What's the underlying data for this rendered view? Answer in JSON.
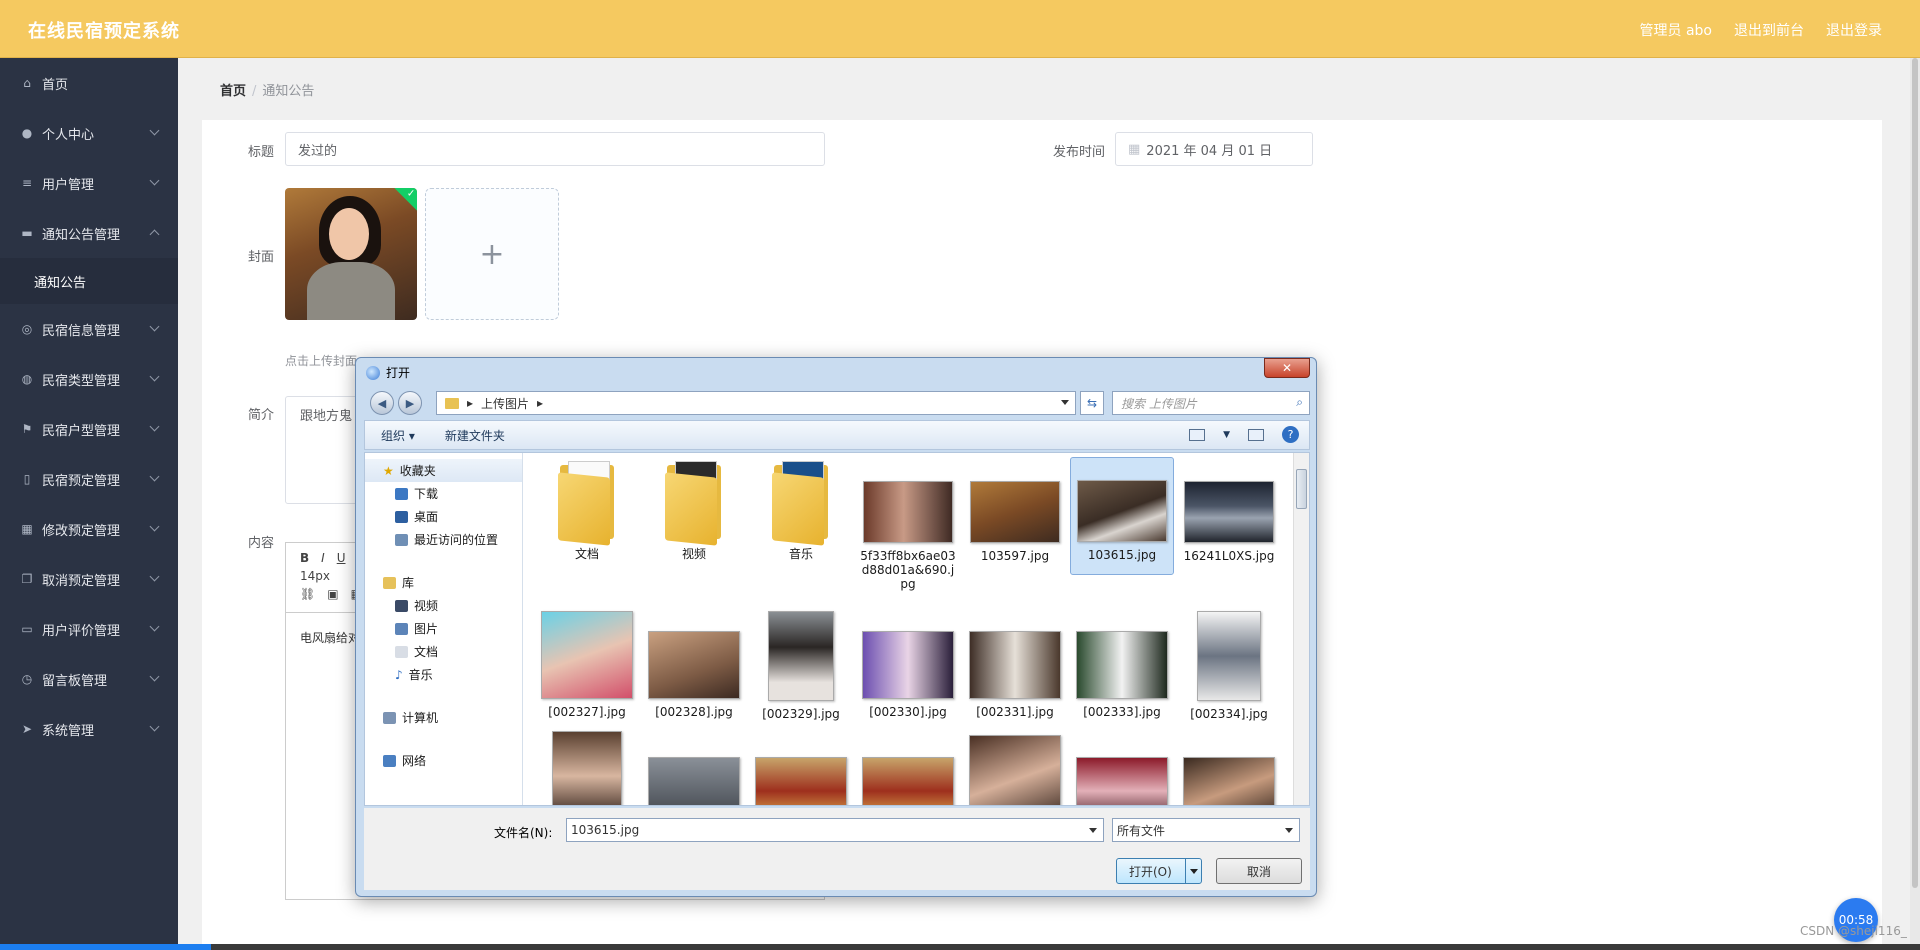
{
  "app": {
    "title": "在线民宿预定系统",
    "nav": [
      "管理员 abo",
      "退出到前台",
      "退出登录"
    ]
  },
  "sidebar": {
    "items": [
      {
        "label": "首页",
        "icon": "home-icon"
      },
      {
        "label": "个人中心",
        "icon": "user-icon"
      },
      {
        "label": "用户管理",
        "icon": "list-icon"
      },
      {
        "label": "通知公告管理",
        "icon": "briefcase-icon",
        "expanded": true
      },
      {
        "label": "民宿信息管理",
        "icon": "compass-icon"
      },
      {
        "label": "民宿类型管理",
        "icon": "globe-icon"
      },
      {
        "label": "民宿户型管理",
        "icon": "flag-icon"
      },
      {
        "label": "民宿预定管理",
        "icon": "bulb-icon"
      },
      {
        "label": "修改预定管理",
        "icon": "grid-icon"
      },
      {
        "label": "取消预定管理",
        "icon": "copy-icon"
      },
      {
        "label": "用户评价管理",
        "icon": "card-icon"
      },
      {
        "label": "留言板管理",
        "icon": "clock-icon"
      },
      {
        "label": "系统管理",
        "icon": "send-icon"
      }
    ],
    "sub_item": "通知公告"
  },
  "breadcrumb": {
    "home": "首页",
    "sep": "/",
    "current": "通知公告"
  },
  "form": {
    "title_label": "标题",
    "title_value": "发过的",
    "date_label": "发布时间",
    "date_value": "2021 年 04 月 01 日",
    "cover_label": "封面",
    "cover_tip": "点击上传封面",
    "intro_label": "简介",
    "intro_value": "跟地方鬼",
    "content_label": "内容",
    "editor_font_size": "14px",
    "editor_text": "电风扇给对"
  },
  "dialog": {
    "title": "打开",
    "close": "✕",
    "path": "上传图片",
    "search_placeholder": "搜索 上传图片",
    "toolbar": {
      "organize": "组织 ▾",
      "new_folder": "新建文件夹"
    },
    "nav_tree": {
      "favorites": "收藏夹",
      "downloads": "下载",
      "desktop": "桌面",
      "recent": "最近访问的位置",
      "libraries": "库",
      "videos": "视频",
      "pictures": "图片",
      "documents": "文档",
      "music": "音乐",
      "computer": "计算机",
      "network": "网络"
    },
    "files_row1": [
      "文档",
      "视频",
      "音乐",
      "5f33ff8bx6ae03d88d01a&690.jpg",
      "103597.jpg",
      "103615.jpg",
      "16241L0XS.jpg"
    ],
    "files_row1_display": [
      "文档",
      "视频",
      "音乐",
      "5f33ff8bx6ae03\nd88d01a&690.j\npg",
      "103597.jpg",
      "103615.jpg",
      "16241L0XS.jpg"
    ],
    "files_row2": [
      "[002327].jpg",
      "[002328].jpg",
      "[002329].jpg",
      "[002330].jpg",
      "[002331].jpg",
      "[002333].jpg",
      "[002334].jpg"
    ],
    "filename_label": "文件名(N):",
    "filename_value": "103615.jpg",
    "filetype_value": "所有文件",
    "open_button": "打开(O)",
    "cancel_button": "取消"
  },
  "overlay": {
    "timer": "00:58",
    "watermark": "CSDN @sheji116_",
    "video_progress": 0.11
  },
  "colors": {
    "header": "#f5c960",
    "sidebar": "#2b3344",
    "accent": "#1c7ef0"
  }
}
